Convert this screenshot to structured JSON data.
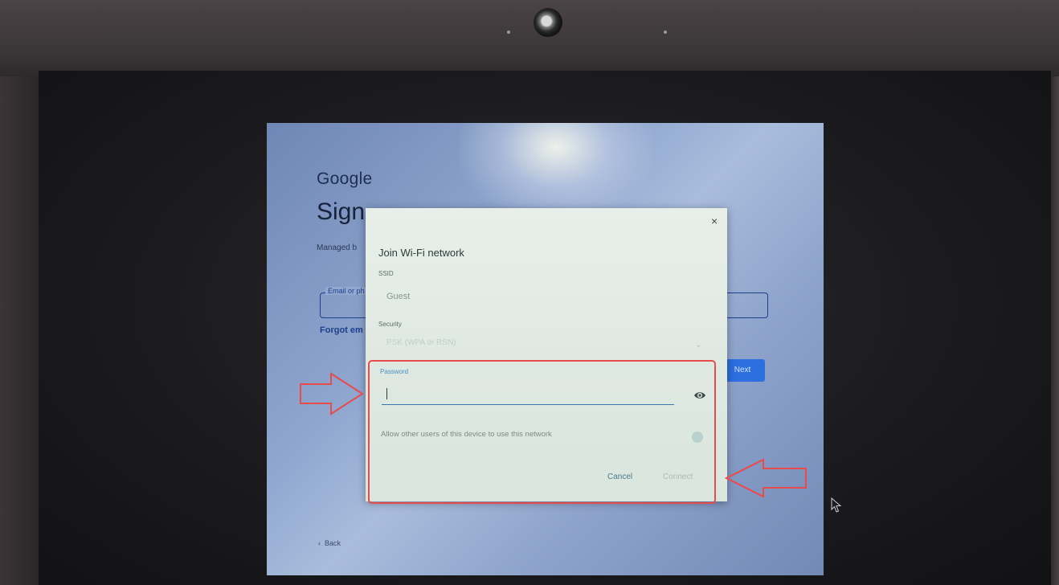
{
  "signin": {
    "logo": "Google",
    "title": "Sign",
    "managed_text": "Managed b",
    "email_label": "Email or ph",
    "forgot_text": "Forgot em",
    "next_label": "Next",
    "back_label": "Back"
  },
  "dialog": {
    "close_glyph": "×",
    "title": "Join Wi-Fi network",
    "ssid_label": "SSID",
    "ssid_value": "Guest",
    "security_label": "Security",
    "security_value": "PSK (WPA or RSN)",
    "password_label": "Password",
    "password_value": "",
    "allow_text": "Allow other users of this device to use this network",
    "cancel_label": "Cancel",
    "connect_label": "Connect"
  },
  "icons": {
    "close": "close-icon",
    "eye": "eye-icon",
    "back": "chevron-left-icon",
    "dropdown": "chevron-down-icon",
    "cursor": "mouse-pointer-icon"
  },
  "colors": {
    "annotation": "#e84b4b",
    "accent": "#2c6fe0",
    "dialog_bg": "#e3ece6"
  }
}
